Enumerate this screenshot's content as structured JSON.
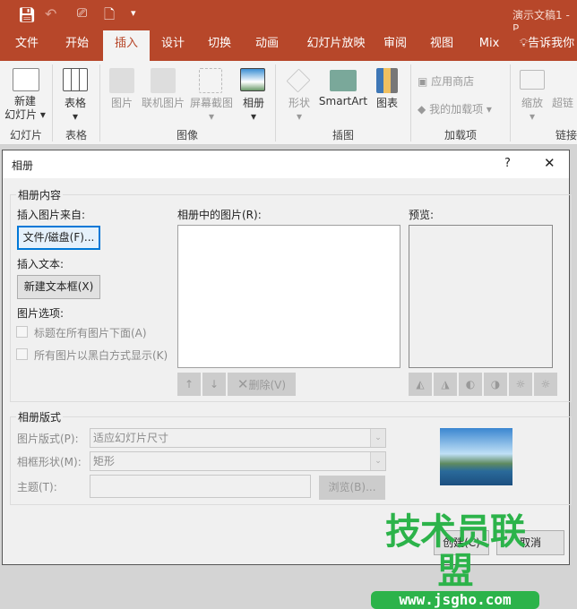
{
  "titlebar": {
    "doc_title": "演示文稿1 - P",
    "qat": [
      "save-icon",
      "undo-icon",
      "present-icon",
      "new-icon",
      "customize-icon"
    ]
  },
  "tabs": [
    "文件",
    "开始",
    "插入",
    "设计",
    "切换",
    "动画",
    "幻灯片放映",
    "审阅",
    "视图",
    "Mix"
  ],
  "active_tab": "插入",
  "tell_me": "告诉我你",
  "ribbon": {
    "new_slide": [
      "新建",
      "幻灯片"
    ],
    "table": "表格",
    "picture": "图片",
    "online_picture": "联机图片",
    "screenshot": "屏幕截图",
    "album": "相册",
    "shapes": "形状",
    "smartart": "SmartArt",
    "chart": "图表",
    "store": "应用商店",
    "my_addins": "我的加载项",
    "zoom": "缩放",
    "hyperlink": "超链",
    "groups": [
      "幻灯片",
      "表格",
      "图像",
      "插图",
      "加载项",
      "链接"
    ]
  },
  "dialog": {
    "title": "相册",
    "help": "?",
    "close": "✕",
    "content_group": "相册内容",
    "insert_from": "插入图片来自:",
    "file_disk_button": "文件/磁盘(F)...",
    "insert_text": "插入文本:",
    "new_textbox_button": "新建文本框(X)",
    "picture_options": "图片选项:",
    "cb_captions": "标题在所有图片下面(A)",
    "cb_blackwhite": "所有图片以黑白方式显示(K)",
    "pictures_in_album": "相册中的图片(R):",
    "delete_button": "删除(V)",
    "preview": "预览:",
    "layout_group": "相册版式",
    "picture_layout_label": "图片版式(P):",
    "picture_layout_value": "适应幻灯片尺寸",
    "frame_shape_label": "相框形状(M):",
    "frame_shape_value": "矩形",
    "theme_label": "主题(T):",
    "theme_value": "",
    "browse_button": "浏览(B)...",
    "create_button": "创建(C)",
    "cancel_button": "取消"
  },
  "watermark": {
    "text": "技术员联盟",
    "url": "www.jsgho.com",
    "color": "#2cb34a"
  }
}
